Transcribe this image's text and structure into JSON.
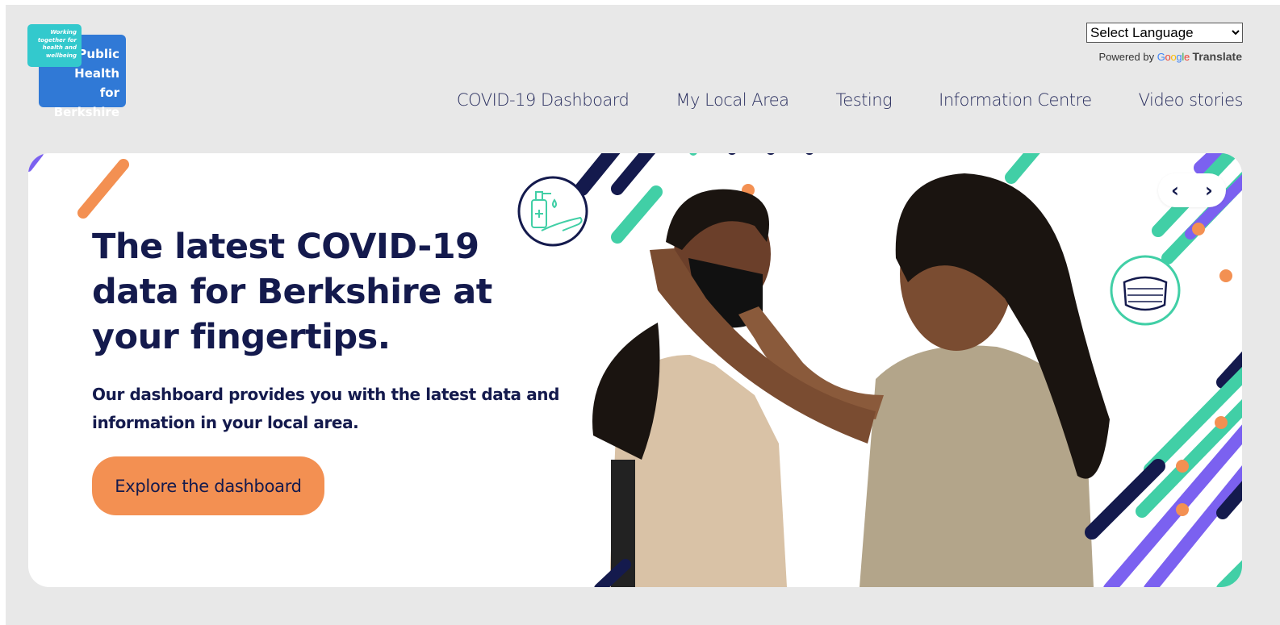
{
  "logo": {
    "tagline_lines": [
      "Working",
      "together for",
      "health and",
      "wellbeing"
    ],
    "name_lines": [
      "Public",
      "Health",
      "for Berkshire"
    ]
  },
  "translate": {
    "select_label": "Select Language",
    "powered_by": "Powered by",
    "google": "Google",
    "translate_word": "Translate"
  },
  "nav": {
    "items": [
      {
        "label": "COVID-19 Dashboard"
      },
      {
        "label": "My Local Area"
      },
      {
        "label": "Testing"
      },
      {
        "label": "Information Centre"
      },
      {
        "label": "Video stories"
      }
    ]
  },
  "hero": {
    "title": "The latest COVID-19 data for Berkshire at your fingertips.",
    "subtitle": "Our dashboard provides you with the latest data and information in your local area.",
    "cta_label": "Explore the dashboard",
    "prev_label": "‹",
    "next_label": "›"
  },
  "colors": {
    "navy": "#141a4d",
    "teal": "#41cfa6",
    "purple": "#7b61f0",
    "orange": "#f39052",
    "logo_blue": "#3079d6",
    "logo_teal": "#33c9cd",
    "page_bg": "#e8e8e8"
  },
  "icons": [
    "hand-sanitizer-icon",
    "face-mask-icon",
    "chevron-left-icon",
    "chevron-right-icon"
  ]
}
